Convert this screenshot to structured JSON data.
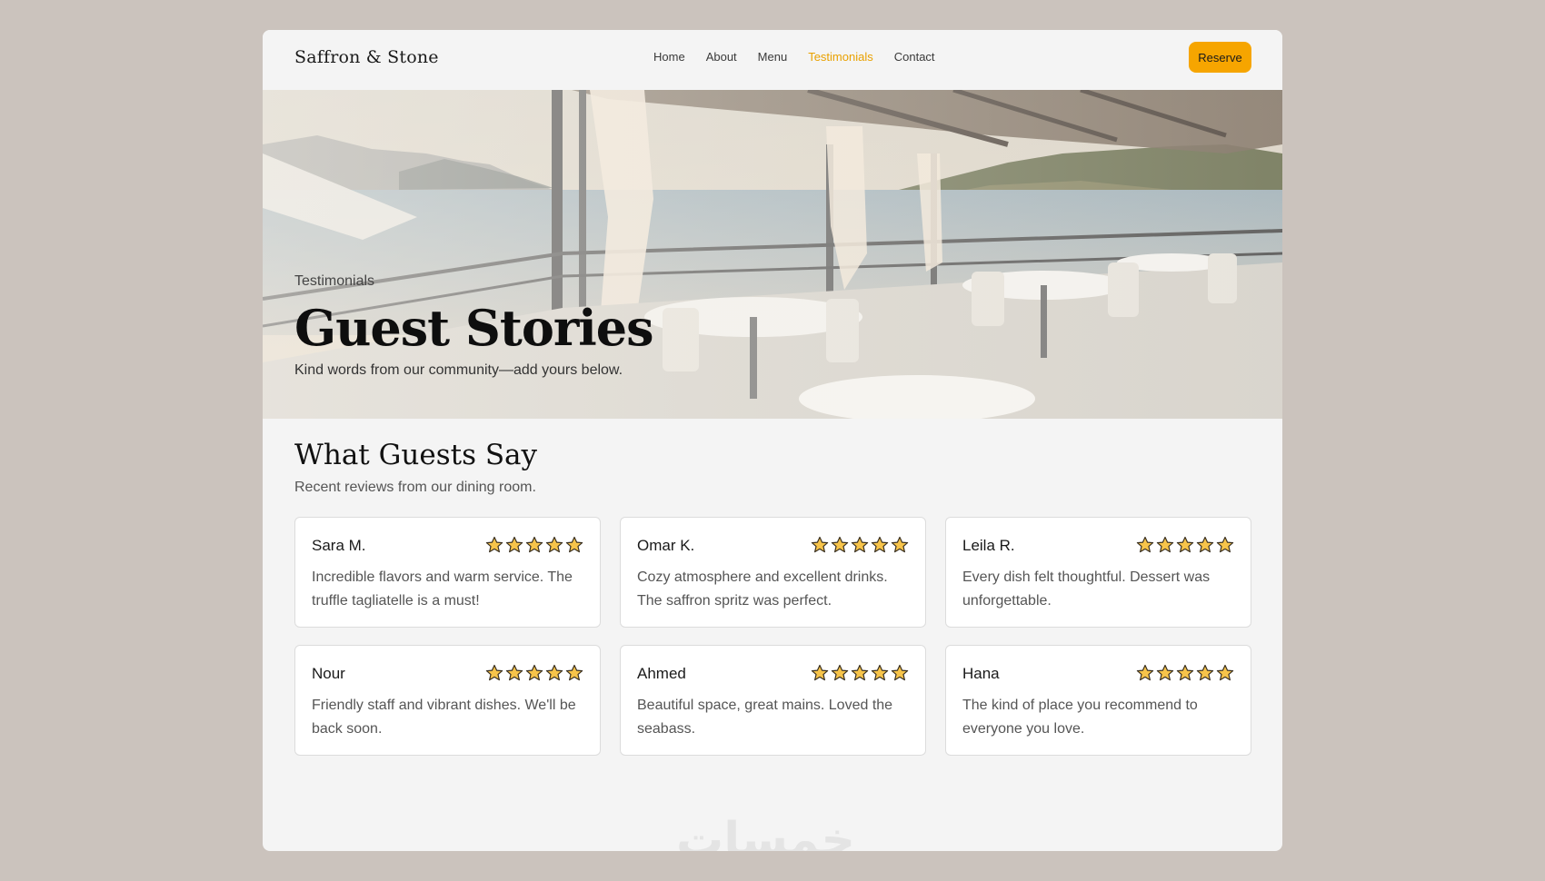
{
  "brand": "Saffron & Stone",
  "nav": {
    "items": [
      "Home",
      "About",
      "Menu",
      "Testimonials",
      "Contact"
    ],
    "active": "Testimonials"
  },
  "reserve_label": "Reserve",
  "hero": {
    "kicker": "Testimonials",
    "title": "Guest Stories",
    "subtitle": "Kind words from our community—add yours below."
  },
  "section": {
    "title": "What Guests Say",
    "subtitle": "Recent reviews from our dining room."
  },
  "reviews": [
    {
      "name": "Sara M.",
      "rating": 5,
      "text": "Incredible flavors and warm service. The truffle tagliatelle is a must!"
    },
    {
      "name": "Omar K.",
      "rating": 5,
      "text": "Cozy atmosphere and excellent drinks. The saffron spritz was perfect."
    },
    {
      "name": "Leila R.",
      "rating": 5,
      "text": "Every dish felt thoughtful. Dessert was unforgettable."
    },
    {
      "name": "Nour",
      "rating": 5,
      "text": "Friendly staff and vibrant dishes. We'll be back soon."
    },
    {
      "name": "Ahmed",
      "rating": 5,
      "text": "Beautiful space, great mains. Loved the seabass."
    },
    {
      "name": "Hana",
      "rating": 5,
      "text": "The kind of place you recommend to everyone you love."
    }
  ],
  "watermark": "خمسات",
  "colors": {
    "accent": "#f6a500",
    "nav_active": "#e9a100",
    "star_fill": "#f7c44a",
    "page_bg": "#cbc3bd"
  }
}
